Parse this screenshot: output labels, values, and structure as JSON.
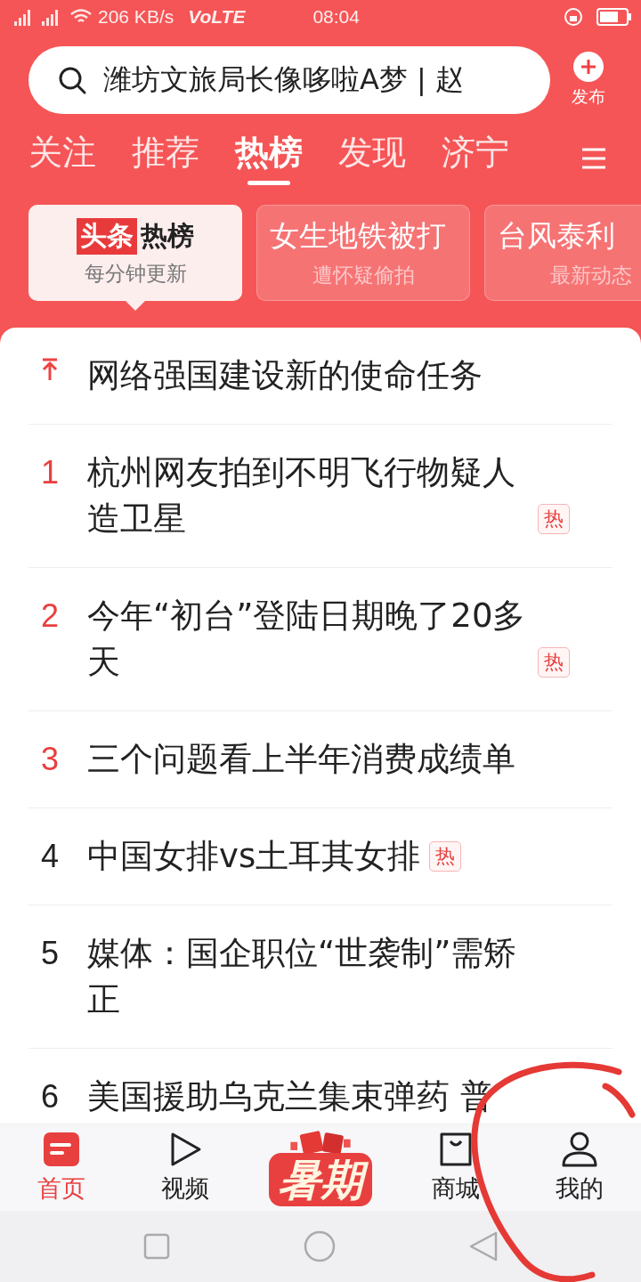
{
  "status_bar": {
    "speed": "206 KB/s",
    "network": "VoLTE",
    "time": "08:04"
  },
  "search": {
    "value": "潍坊文旅局长像哆啦A梦 | 赵"
  },
  "publish": {
    "label": "发布"
  },
  "tabs": [
    {
      "label": "关注",
      "selected": false
    },
    {
      "label": "推荐",
      "selected": false
    },
    {
      "label": "热榜",
      "selected": true
    },
    {
      "label": "发现",
      "selected": false
    },
    {
      "label": "济宁",
      "selected": false
    }
  ],
  "cards": [
    {
      "kind": "logo",
      "brand": "头条",
      "title": "热榜",
      "subtitle": "每分钟更新",
      "selected": true
    },
    {
      "kind": "topic",
      "title": "女生地铁被打",
      "subtitle": "遭怀疑偷拍",
      "selected": false
    },
    {
      "kind": "topic",
      "title": "台风泰利",
      "subtitle": "最新动态",
      "selected": false
    }
  ],
  "list": [
    {
      "kind": "pinned",
      "title": "网络强国建设新的使命任务",
      "hot": false
    },
    {
      "kind": "ranked",
      "rank": "1",
      "highlight": true,
      "title": "杭州网友拍到不明飞行物疑人造卫星",
      "hot": true,
      "badge": "热"
    },
    {
      "kind": "ranked",
      "rank": "2",
      "highlight": true,
      "title": "今年“初台”登陆日期晚了20多天",
      "hot": true,
      "badge": "热"
    },
    {
      "kind": "ranked",
      "rank": "3",
      "highlight": true,
      "title": "三个问题看上半年消费成绩单",
      "hot": false
    },
    {
      "kind": "ranked",
      "rank": "4",
      "highlight": false,
      "title": "中国女排vs土耳其女排",
      "hot": true,
      "badge": "热"
    },
    {
      "kind": "ranked",
      "rank": "5",
      "highlight": false,
      "title": "媒体：国企职位“世袭制”需矫正",
      "hot": false
    },
    {
      "kind": "ranked",
      "rank": "6",
      "highlight": false,
      "title": "美国援助乌克兰集束弹药 普",
      "hot": false
    }
  ],
  "bottom_nav": [
    {
      "kind": "home",
      "label": "首页",
      "selected": true
    },
    {
      "kind": "video",
      "label": "视频",
      "selected": false
    },
    {
      "kind": "promo",
      "label": "暑期",
      "selected": false
    },
    {
      "kind": "mall",
      "label": "商城",
      "selected": false
    },
    {
      "kind": "me",
      "label": "我的",
      "selected": false
    }
  ]
}
